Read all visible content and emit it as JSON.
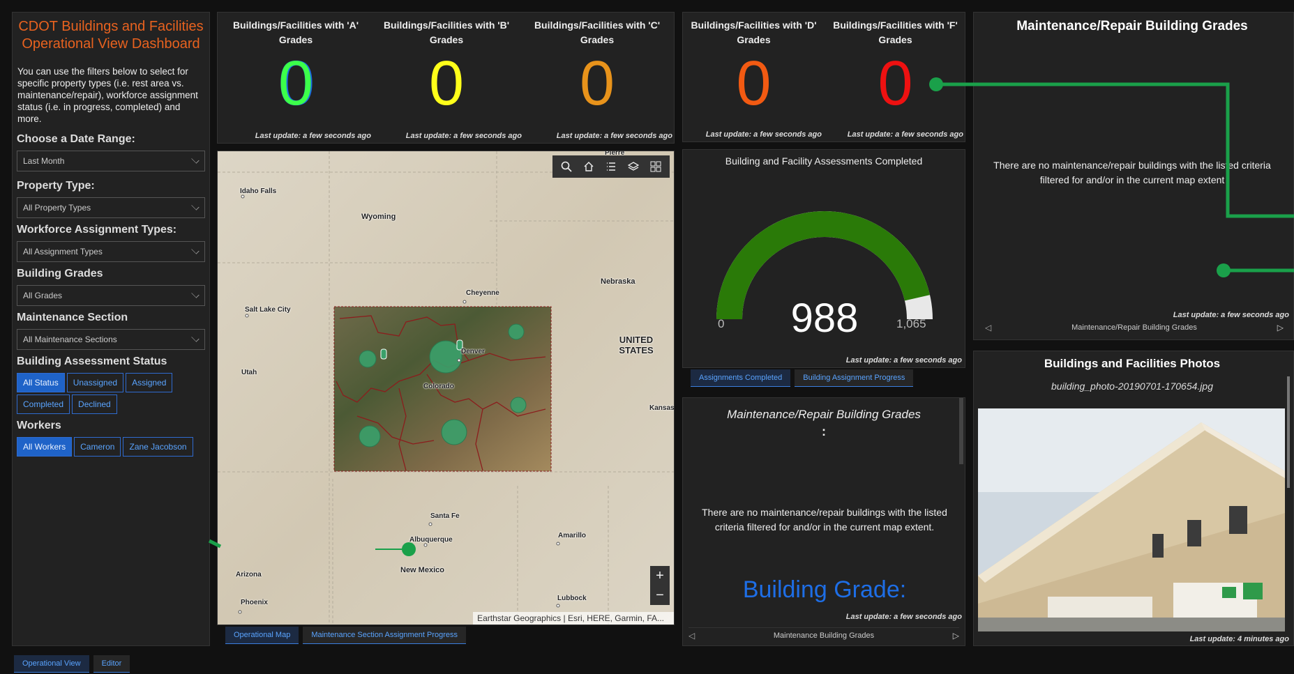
{
  "sidebar": {
    "title": "CDOT Buildings and Facilities Operational View Dashboard",
    "description": "You can use the filters below to select for specific property types (i.e. rest area vs. maintenance/repair), workforce assignment status (i.e. in progress, completed) and more.",
    "date_label": "Choose a Date Range:",
    "date_value": "Last Month",
    "property_label": "Property Type:",
    "property_value": "All Property Types",
    "workforce_label": "Workforce Assignment Types:",
    "workforce_value": "All Assignment Types",
    "grades_label": "Building Grades",
    "grades_value": "All Grades",
    "section_label": "Maintenance Section",
    "section_value": "All Maintenance Sections",
    "status_label": "Building Assessment Status",
    "status_buttons": [
      "All Status",
      "Unassigned",
      "Assigned",
      "Completed",
      "Declined"
    ],
    "workers_label": "Workers",
    "worker_buttons": [
      "All Workers",
      "Cameron",
      "Zane Jacobson"
    ]
  },
  "kpis": [
    {
      "title": "Buildings/Facilities with 'A' Grades",
      "value": "0",
      "color": "#3cff4a",
      "updated": "Last update: a few seconds ago"
    },
    {
      "title": "Buildings/Facilities with 'B' Grades",
      "value": "0",
      "color": "#ffff1a",
      "updated": "Last update: a few seconds ago"
    },
    {
      "title": "Buildings/Facilities with 'C' Grades",
      "value": "0",
      "color": "#e8931b",
      "updated": "Last update: a few seconds ago"
    },
    {
      "title": "Buildings/Facilities with 'D' Grades",
      "value": "0",
      "color": "#f25a12",
      "updated": "Last update: a few seconds ago"
    },
    {
      "title": "Buildings/Facilities with 'F' Grades",
      "value": "0",
      "color": "#ee1111",
      "updated": "Last update: a few seconds ago"
    }
  ],
  "map": {
    "labels": [
      "Idaho Falls",
      "Wyoming",
      "Cheyenne",
      "Nebraska",
      "Salt Lake City",
      "UNITED STATES",
      "Utah",
      "Denver",
      "Colorado",
      "Kansas",
      "Santa Fe",
      "Albuquerque",
      "Amarillo",
      "New Mexico",
      "Arizona",
      "Phoenix",
      "Lubbock",
      "Pierre"
    ],
    "attribution": "Earthstar Geographics | Esri, HERE, Garmin, FA...",
    "tabs": [
      "Operational Map",
      "Maintenance Section Assignment Progress"
    ],
    "accent": "#3aa06a"
  },
  "gauge": {
    "title": "Building and Facility Assessments Completed",
    "value": 988,
    "value_text": "988",
    "min": "0",
    "max": "1,065",
    "max_num": 1065,
    "fill_color": "#2a7a08",
    "updated": "Last update: a few seconds ago",
    "tabs": [
      "Assignments Completed",
      "Building Assignment Progress"
    ]
  },
  "grade_detail": {
    "title": "Maintenance/Repair Building Grades",
    "colon": ":",
    "message": "There are no maintenance/repair buildings with the listed criteria filtered for and/or in the current map extent.",
    "grade_label": "Building Grade:",
    "updated": "Last update: a few seconds ago",
    "nav_label": "Maintenance Building Grades"
  },
  "top_right": {
    "title": "Maintenance/Repair Building Grades",
    "message": "There are no maintenance/repair buildings with the listed criteria filtered for and/or in the current map extent",
    "updated": "Last update: a few seconds ago",
    "nav_label": "Maintenance/Repair Building Grades"
  },
  "photos": {
    "title": "Buildings and Facilities Photos",
    "filename": "building_photo-20190701-170654.jpg",
    "updated": "Last update: 4 minutes ago"
  },
  "bottom_tabs": [
    "Operational View",
    "Editor"
  ]
}
